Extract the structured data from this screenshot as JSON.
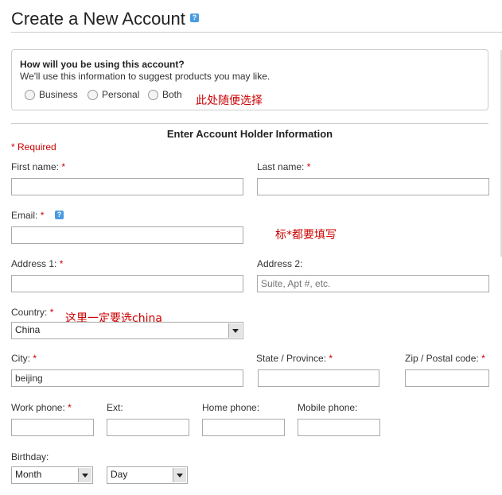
{
  "header": {
    "title": "Create a New Account",
    "help_glyph": "?"
  },
  "usage": {
    "question": "How will you be using this account?",
    "subtext": "We'll use this information to suggest products you may like.",
    "options": [
      "Business",
      "Personal",
      "Both"
    ],
    "note": "此处随便选择"
  },
  "form": {
    "section_title": "Enter Account Holder Information",
    "required_note": "* Required",
    "first_name": {
      "label": "First name:",
      "value": ""
    },
    "last_name": {
      "label": "Last name:",
      "value": ""
    },
    "email": {
      "label": "Email:",
      "value": "",
      "note": "标*都要填写"
    },
    "address1": {
      "label": "Address 1:",
      "value": ""
    },
    "address2": {
      "label": "Address 2:",
      "placeholder": "Suite, Apt #, etc."
    },
    "country": {
      "label": "Country:",
      "value": "China",
      "note": "这里一定要选china"
    },
    "city": {
      "label": "City:",
      "value": "beijing"
    },
    "state": {
      "label": "State / Province:",
      "value": ""
    },
    "zip": {
      "label": "Zip / Postal code:",
      "value": ""
    },
    "work_phone": {
      "label": "Work phone:"
    },
    "ext": {
      "label": "Ext:"
    },
    "home_phone": {
      "label": "Home phone:"
    },
    "mobile_phone": {
      "label": "Mobile phone:"
    },
    "birthday": {
      "label": "Birthday:",
      "month": "Month",
      "day": "Day"
    },
    "required_marker": "*"
  },
  "colors": {
    "required": "#cc0000",
    "note": "#cc0000",
    "help_icon": "#4a9be0"
  }
}
